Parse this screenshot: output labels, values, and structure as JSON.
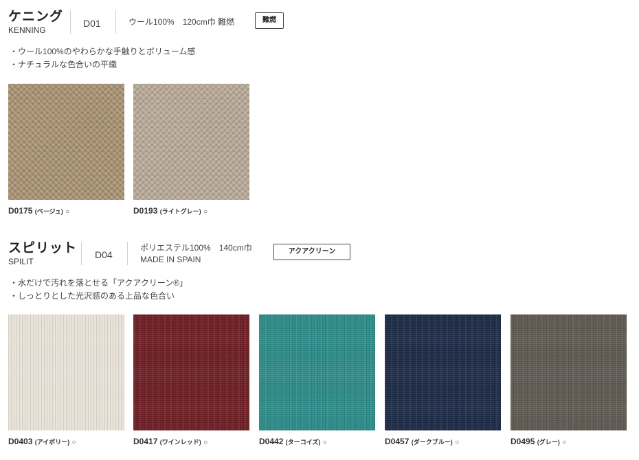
{
  "sections": [
    {
      "name_ja": "ケニング",
      "name_en": "KENNING",
      "code": "D01",
      "spec_line1": "ウール100%　120cm巾 難燃",
      "spec_line2": "",
      "badge": "難燃",
      "bullets": [
        "ウール100%のやわらかな手触りとボリューム感",
        "ナチュラルな色合いの平織"
      ],
      "samples": [
        {
          "code": "D0175",
          "color_name": "(ベージュ)",
          "mark": "○",
          "swatch_color": "#a99373"
        },
        {
          "code": "D0193",
          "color_name": "(ライトグレー)",
          "mark": "○",
          "swatch_color": "#b9aa98"
        }
      ]
    },
    {
      "name_ja": "スピリット",
      "name_en": "SPILIT",
      "code": "D04",
      "spec_line1": "ポリエステル100%　140cm巾",
      "spec_line2": "MADE IN SPAIN",
      "badge": "アクアクリーン",
      "bullets": [
        "水だけで汚れを落とせる「アクアクリーン®」",
        "しっとりとした光沢感のある上品な色合い"
      ],
      "samples": [
        {
          "code": "D0403",
          "color_name": "(アイボリー)",
          "mark": "○",
          "swatch_color": "#e8e2d8"
        },
        {
          "code": "D0417",
          "color_name": "(ワインレッド)",
          "mark": "○",
          "swatch_color": "#6d1e24"
        },
        {
          "code": "D0442",
          "color_name": "(ターコイズ)",
          "mark": "○",
          "swatch_color": "#2d8a87"
        },
        {
          "code": "D0457",
          "color_name": "(ダークブルー)",
          "mark": "○",
          "swatch_color": "#1d2a45"
        },
        {
          "code": "D0495",
          "color_name": "(グレー)",
          "mark": "○",
          "swatch_color": "#5e5851"
        }
      ]
    }
  ]
}
